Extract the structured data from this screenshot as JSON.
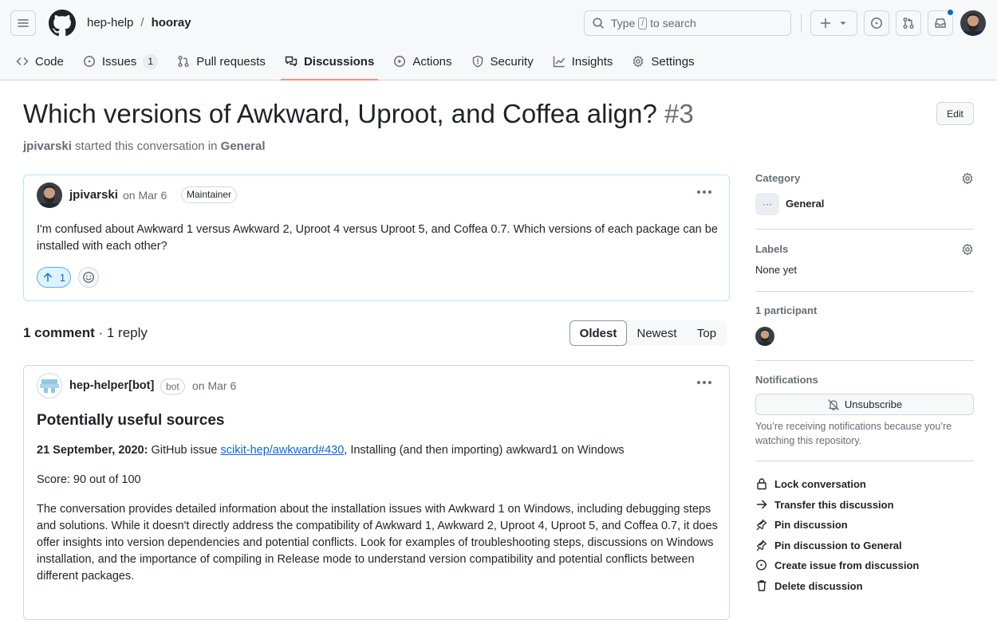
{
  "header": {
    "owner": "hep-help",
    "separator": "/",
    "repo": "hooray",
    "search": {
      "prefix": "Type",
      "key": "/",
      "suffix": "to search"
    }
  },
  "tabs": [
    {
      "label": "Code",
      "icon": "code-icon"
    },
    {
      "label": "Issues",
      "icon": "issue-icon",
      "count": "1"
    },
    {
      "label": "Pull requests",
      "icon": "pull-request-icon"
    },
    {
      "label": "Discussions",
      "icon": "discussion-icon",
      "active": true
    },
    {
      "label": "Actions",
      "icon": "play-icon"
    },
    {
      "label": "Security",
      "icon": "shield-icon"
    },
    {
      "label": "Insights",
      "icon": "graph-icon"
    },
    {
      "label": "Settings",
      "icon": "gear-icon"
    }
  ],
  "discussion": {
    "title": "Which versions of Awkward, Uproot, and Coffea align?",
    "number": "#3",
    "edit_label": "Edit",
    "started_by": "jpivarski",
    "started_text": "started this conversation in",
    "category": "General"
  },
  "post": {
    "author": "jpivarski",
    "date": "on Mar 6",
    "role": "Maintainer",
    "body": "I'm confused about Awkward 1 versus Awkward 2, Uproot 4 versus Uproot 5, and Coffea 0.7. Which versions of each package can be installed with each other?",
    "upvotes": "1"
  },
  "comments_bar": {
    "count_bold": "1 comment",
    "rest": " · 1 reply",
    "sort": [
      "Oldest",
      "Newest",
      "Top"
    ],
    "sort_active": "Oldest"
  },
  "comment": {
    "author": "hep-helper[bot]",
    "badge": "bot",
    "date": "on Mar 6",
    "heading": "Potentially useful sources",
    "source_date": "21 September, 2020:",
    "source_prefix": " GitHub issue ",
    "source_link": "scikit-hep/awkward#430",
    "source_suffix": ", Installing (and then importing) awkward1 on Windows",
    "score": "Score: 90 out of 100",
    "summary": "The conversation provides detailed information about the installation issues with Awkward 1 on Windows, including debugging steps and solutions. While it doesn't directly address the compatibility of Awkward 1, Awkward 2, Uproot 4, Uproot 5, and Coffea 0.7, it does offer insights into version dependencies and potential conflicts. Look for examples of troubleshooting steps, discussions on Windows installation, and the importance of compiling in Release mode to understand version compatibility and potential conflicts between different packages."
  },
  "sidebar": {
    "category_heading": "Category",
    "category_value": "General",
    "category_emoji": "···",
    "labels_heading": "Labels",
    "labels_value": "None yet",
    "participants_heading": "1 participant",
    "notifications_heading": "Notifications",
    "unsubscribe_label": "Unsubscribe",
    "notif_text": "You’re receiving notifications because you’re watching this repository.",
    "actions": [
      {
        "label": "Lock conversation",
        "icon": "lock-icon"
      },
      {
        "label": "Transfer this discussion",
        "icon": "arrow-right-icon"
      },
      {
        "label": "Pin discussion",
        "icon": "pin-icon"
      },
      {
        "label": "Pin discussion to General",
        "icon": "pin-icon"
      },
      {
        "label": "Create issue from discussion",
        "icon": "issue-icon"
      },
      {
        "label": "Delete discussion",
        "icon": "trash-icon"
      }
    ]
  },
  "colors": {
    "accent": "#0969da",
    "tab_underline": "#fd8c73",
    "border": "#d0d7de",
    "muted": "#656d76"
  }
}
